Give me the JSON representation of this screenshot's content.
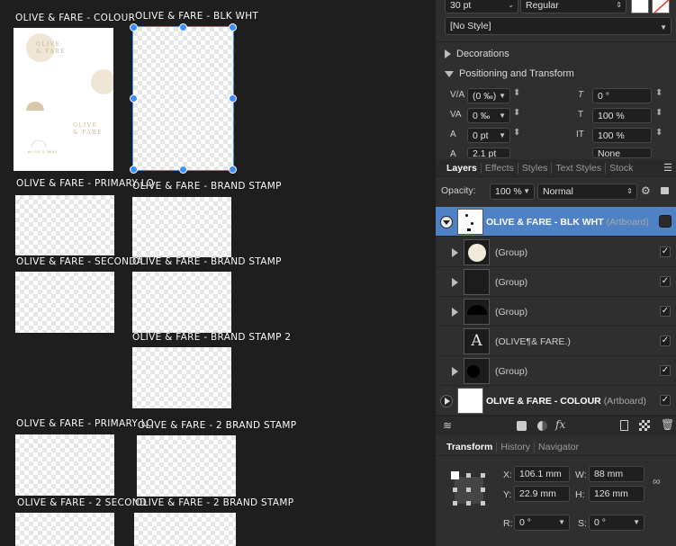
{
  "canvas": {
    "artboards": [
      {
        "label": "OLIVE & FARE - COLOUR"
      },
      {
        "label": "OLIVE & FARE - BLK WHT"
      },
      {
        "label": "OLIVE & FARE - PRIMARY LO"
      },
      {
        "label": "OLIVE & FARE - BRAND STAMP"
      },
      {
        "label": "OLIVE & FARE - SECONDA"
      },
      {
        "label": "OLIVE & FARE -  BRAND STAMP"
      },
      {
        "label": "OLIVE & FARE - BRAND STAMP 2"
      },
      {
        "label": "OLIVE & FARE - PRIMARY LO"
      },
      {
        "label": "OLIVE & FARE - 2 BRAND STAMP"
      },
      {
        "label": "OLIVE & FARE - 2 SECOND"
      },
      {
        "label": "OLIVE & FARE - 2 BRAND STAMP"
      }
    ],
    "logo_text_1": "OLIVE",
    "logo_text_2": "& FARE",
    "logo_text_3": "OLIVE",
    "logo_text_4": "& FARE",
    "logo_text_5": "OLIVE & FARE"
  },
  "character": {
    "font_size": "30 pt",
    "font_weight": "Regular",
    "paragraph_style": "[No Style]"
  },
  "sections": {
    "decorations": "Decorations",
    "positioning": "Positioning and Transform"
  },
  "positioning": {
    "kerning": "(0 ‰)",
    "tracking": "0 ‰",
    "baseline": "0 pt",
    "leading": "2.1 pt",
    "shear": "0 °",
    "horiz_scale": "100 %",
    "vert_scale": "100 %",
    "caps": "None"
  },
  "layers_tabs": [
    "Layers",
    "Effects",
    "Styles",
    "Text Styles",
    "Stock"
  ],
  "opacity": {
    "label": "Opacity:",
    "value": "100 %",
    "blend": "Normal"
  },
  "layers": [
    {
      "name": "OLIVE & FARE - BLK WHT",
      "kind": "(Artboard)"
    },
    {
      "name": "(Group)"
    },
    {
      "name": "(Group)"
    },
    {
      "name": "(Group)"
    },
    {
      "name": "(OLIVE¶& FARE.)",
      "thumb_text": "A"
    },
    {
      "name": "(Group)"
    },
    {
      "name": "OLIVE & FARE - COLOUR",
      "kind": "(Artboard)"
    }
  ],
  "transform_tabs": [
    "Transform",
    "History",
    "Navigator"
  ],
  "transform": {
    "x_label": "X:",
    "x": "106.1 mm",
    "y_label": "Y:",
    "y": "22.9 mm",
    "w_label": "W:",
    "w": "88 mm",
    "h_label": "H:",
    "h": "126 mm",
    "r_label": "R:",
    "r": "0 °",
    "s_label": "S:",
    "s": "0 °"
  },
  "colors": {
    "selection": "#3b8fff",
    "layer_selected": "#4e82c4",
    "logo": "#c8b89a"
  }
}
